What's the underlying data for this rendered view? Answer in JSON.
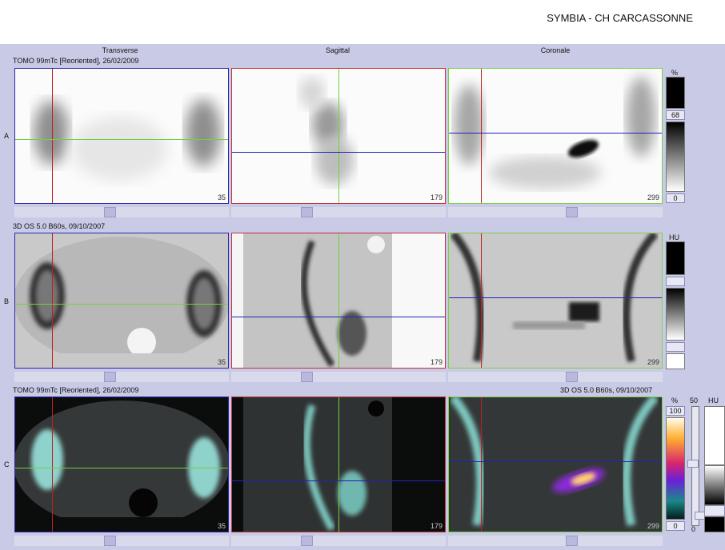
{
  "header": {
    "title": "SYMBIA - CH CARCASSONNE"
  },
  "columns": [
    "Transverse",
    "Sagittal",
    "Coronale"
  ],
  "rows": [
    {
      "letter": "A",
      "series": "TOMO 99mTc [Reoriented], 26/02/2009",
      "nums": [
        "35",
        "179",
        "299"
      ]
    },
    {
      "letter": "B",
      "series": "3D  OS  5.0  B60s, 09/10/2007",
      "nums": [
        "35",
        "179",
        "299"
      ]
    },
    {
      "letter": "C",
      "series": "TOMO 99mTc [Reoriented], 26/02/2009",
      "series_right": "3D  OS  5.0  B60s, 09/10/2007",
      "nums": [
        "35",
        "179",
        "299"
      ]
    }
  ],
  "scales": {
    "a": {
      "unit": "%",
      "level": "68",
      "min": "0"
    },
    "b": {
      "unit": "HU"
    },
    "c": {
      "unit": "%",
      "max": "100",
      "min": "0",
      "blend": "50",
      "unit2": "HU",
      "blend_min": "0"
    }
  },
  "colors": {
    "transverse_border": "#2a2ab0",
    "sagittal_border": "#c03030",
    "coronal_border": "#7ad04a",
    "crosshair_red": "#c02020",
    "crosshair_green": "#6fd040",
    "crosshair_blue": "#2020c0"
  }
}
